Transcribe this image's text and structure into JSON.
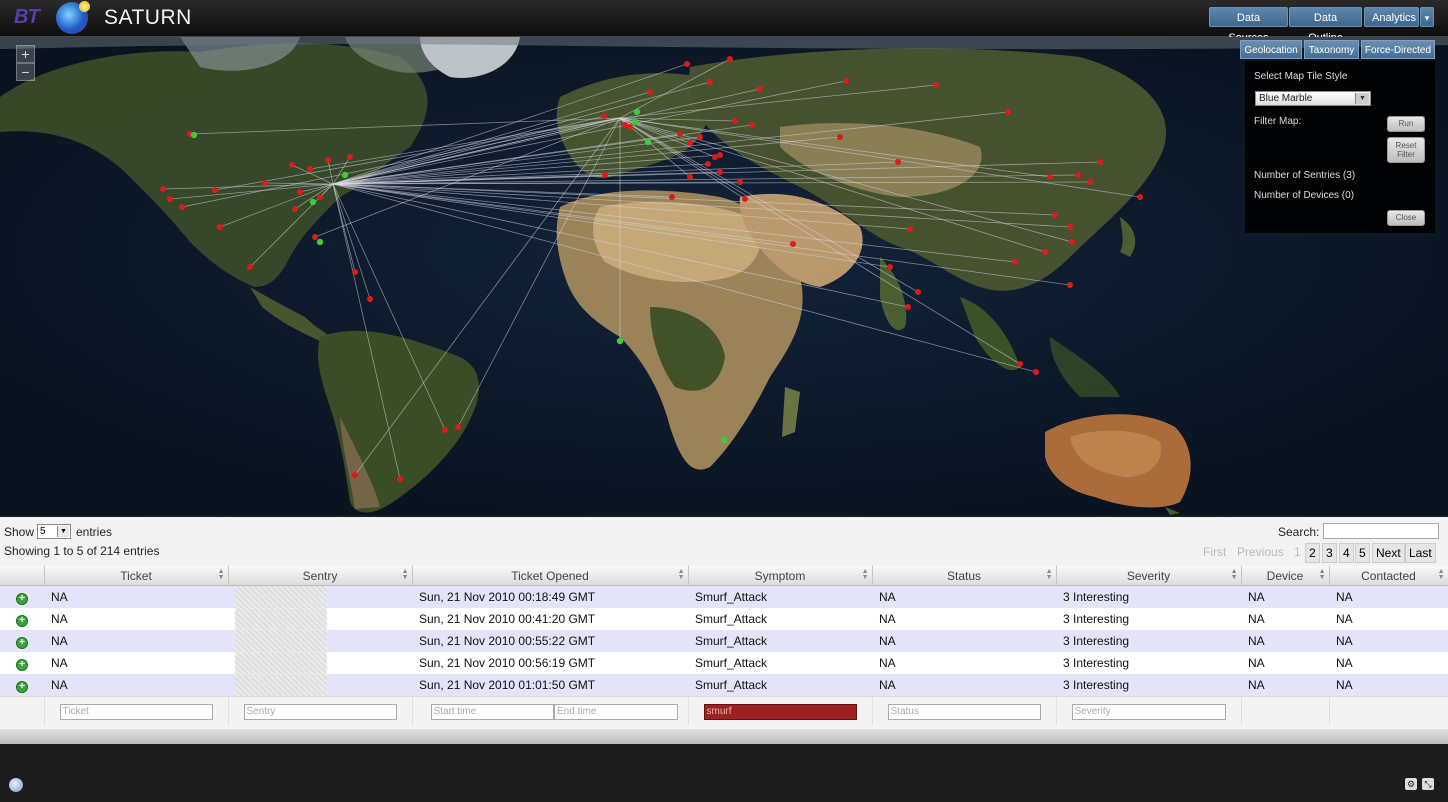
{
  "header": {
    "logo_text": "BT",
    "app_name": "SATURN",
    "nav": [
      "Data Sources",
      "Data Outline",
      "Analytics"
    ],
    "nav_more_icon": "chevron-down-icon"
  },
  "map": {
    "zoom_in": "+",
    "zoom_out": "−",
    "view_tabs": [
      "Geolocation",
      "Taxonomy",
      "Force-Directed"
    ],
    "panel": {
      "tile_style_label": "Select Map Tile Style",
      "tile_style_value": "Blue Marble",
      "filter_label": "Filter Map:",
      "run_label": "Run",
      "reset_label_1": "Reset",
      "reset_label_2": "Filter",
      "sentries_label": "Number of Sentries (3)",
      "devices_label": "Number of Devices (0)",
      "close_label": "Close"
    }
  },
  "table": {
    "show_label": "Show",
    "page_length": "5",
    "entries_label": "entries",
    "info": "Showing 1 to 5 of 214 entries",
    "search_label": "Search:",
    "pagination": {
      "first": "First",
      "previous": "Previous",
      "pages": [
        "1",
        "2",
        "3",
        "4",
        "5"
      ],
      "next": "Next",
      "last": "Last"
    },
    "columns": [
      "Ticket",
      "Sentry",
      "Ticket Opened",
      "Symptom",
      "Status",
      "Severity",
      "Device",
      "Contacted"
    ],
    "rows": [
      {
        "ticket": "NA",
        "opened": "Sun, 21 Nov 2010 00:18:49 GMT",
        "symptom": "Smurf_Attack",
        "status": "NA",
        "severity": "3 Interesting",
        "device": "NA",
        "contacted": "NA"
      },
      {
        "ticket": "NA",
        "opened": "Sun, 21 Nov 2010 00:41:20 GMT",
        "symptom": "Smurf_Attack",
        "status": "NA",
        "severity": "3 Interesting",
        "device": "NA",
        "contacted": "NA"
      },
      {
        "ticket": "NA",
        "opened": "Sun, 21 Nov 2010 00:55:22 GMT",
        "symptom": "Smurf_Attack",
        "status": "NA",
        "severity": "3 Interesting",
        "device": "NA",
        "contacted": "NA"
      },
      {
        "ticket": "NA",
        "opened": "Sun, 21 Nov 2010 00:56:19 GMT",
        "symptom": "Smurf_Attack",
        "status": "NA",
        "severity": "3 Interesting",
        "device": "NA",
        "contacted": "NA"
      },
      {
        "ticket": "NA",
        "opened": "Sun, 21 Nov 2010 01:01:50 GMT",
        "symptom": "Smurf_Attack",
        "status": "NA",
        "severity": "3 Interesting",
        "device": "NA",
        "contacted": "NA"
      }
    ],
    "filters": {
      "ticket": "Ticket",
      "sentry": "Sentry",
      "start_time": "Start time",
      "end_time": "End time",
      "symptom_value": "smurf",
      "status": "Status",
      "severity": "Severity"
    }
  },
  "colors": {
    "sentry_marker": "#3ccc3c",
    "attack_marker": "#e01a1a",
    "attack_line": "#d8d8e8",
    "active_filter": "#9e2020"
  }
}
